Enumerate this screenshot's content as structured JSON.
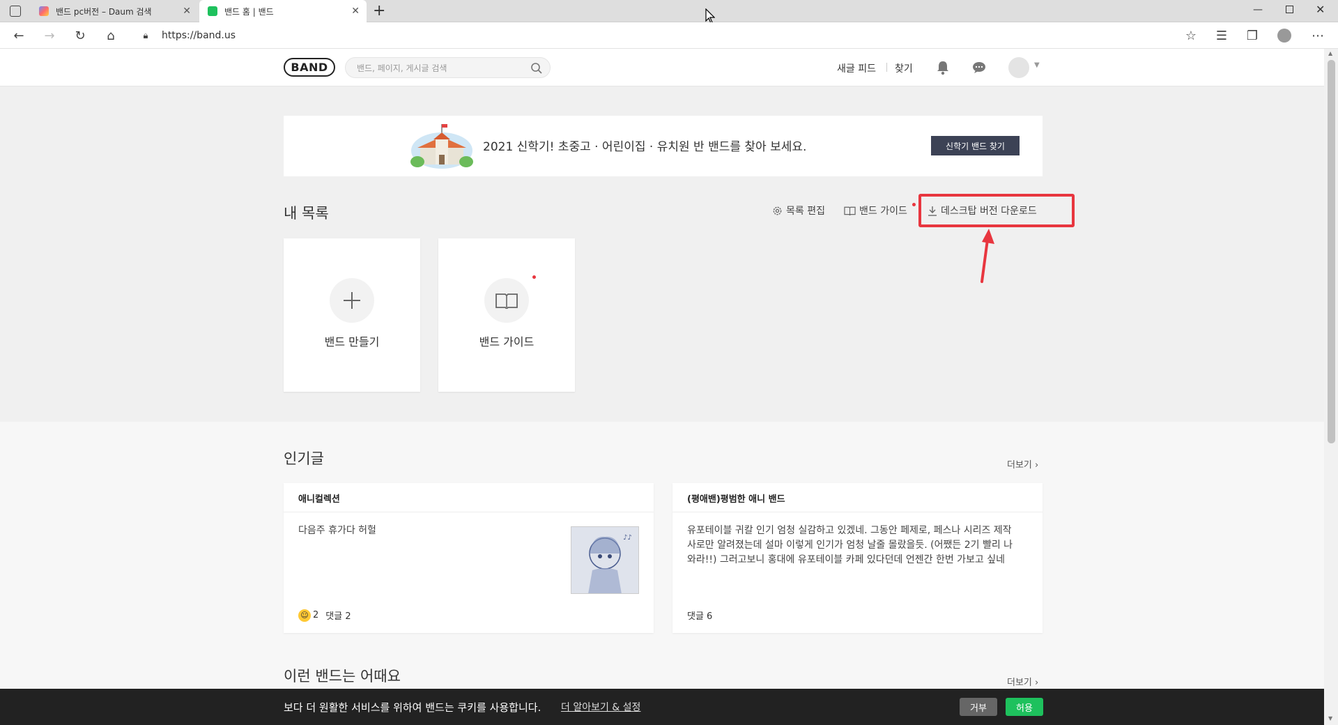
{
  "browser": {
    "tabs": [
      {
        "title": "밴드 pc버전 – Daum 검색"
      },
      {
        "title": "밴드 홈 | 밴드"
      }
    ],
    "new_tab": "+",
    "url": "https://band.us"
  },
  "header": {
    "logo": "BAND",
    "search_placeholder": "밴드, 페이지, 게시글 검색",
    "links": {
      "feed": "새글 피드",
      "find": "찾기"
    }
  },
  "banner": {
    "text": "2021 신학기! 초중고 · 어린이집 · 유치원 반 밴드를 찾아 보세요.",
    "button": "신학기 밴드 찾기"
  },
  "mylist": {
    "title": "내 목록",
    "tools": {
      "edit": "목록 편집",
      "guide": "밴드 가이드",
      "download": "데스크탑 버전 다운로드"
    },
    "cards": [
      {
        "label": "밴드 만들기"
      },
      {
        "label": "밴드 가이드"
      }
    ]
  },
  "popular": {
    "title": "인기글",
    "more": "더보기 ›",
    "posts": [
      {
        "band": "애니컬렉션",
        "body": "다음주 휴가다 허헐",
        "reaction_count": "2",
        "comments": "댓글 2"
      },
      {
        "band": "(평애밴)평범한 애니 밴드",
        "body": "유포테이블 귀칼 인기 엄청 실감하고 있겠네. 그동안 페제로, 페스나 시리즈 제작사로만 알려졌는데 설마 이렇게 인기가 엄청 날줄 몰랐을듯. (어쨌든 2기 빨리 나와라!!) 그러고보니 홍대에 유포테이블 카페 있다던데 언젠간 한번 가보고 싶네",
        "comments": "댓글 6"
      }
    ]
  },
  "suggest": {
    "title": "이런 밴드는 어때요",
    "more": "더보기 ›"
  },
  "cookie": {
    "text": "보다 더 원활한 서비스를 위하여 밴드는 쿠키를 사용합니다.",
    "link": "더 알아보기 & 설정",
    "reject": "거부",
    "accept": "허용"
  },
  "colors": {
    "accent_green": "#1ec15d",
    "highlight_red": "#e8363f",
    "banner_button": "#3c4255"
  }
}
